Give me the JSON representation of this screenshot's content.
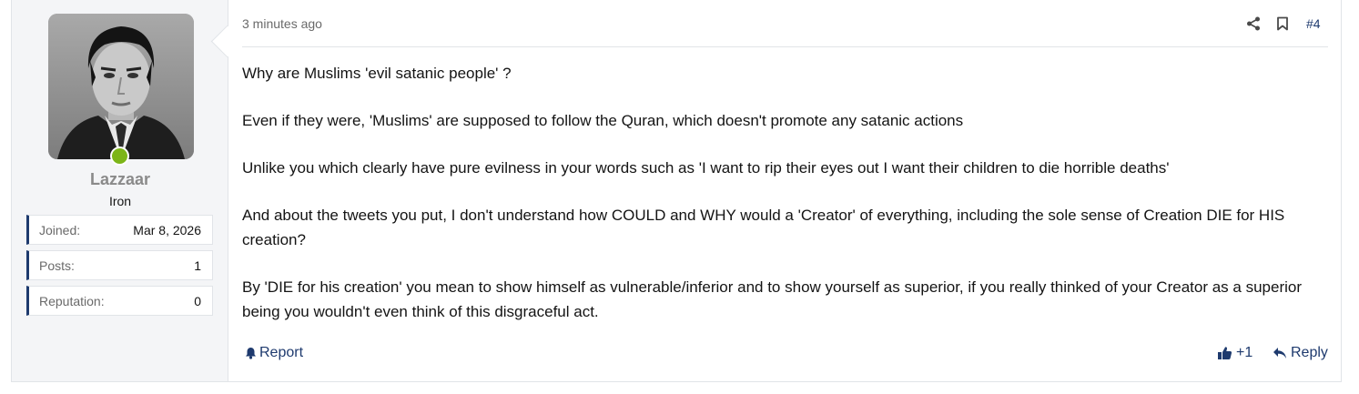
{
  "user": {
    "name": "Lazzaar",
    "title": "Iron",
    "online_color": "#7cb518",
    "stats": [
      {
        "label": "Joined:",
        "value": "Mar 8, 2026"
      },
      {
        "label": "Posts:",
        "value": "1"
      },
      {
        "label": "Reputation:",
        "value": "0"
      }
    ]
  },
  "post": {
    "time": "3 minutes ago",
    "number": "#4",
    "paragraphs": [
      "Why are Muslims 'evil satanic people' ?",
      "Even if they were, 'Muslims' are supposed to follow the Quran, which doesn't promote any satanic actions",
      "Unlike you which clearly have pure evilness in your words such as 'I want to rip their eyes out I want their children to die horrible deaths'",
      "And about the tweets you put, I don't understand how COULD and WHY would a 'Creator' of everything, including the sole sense of Creation DIE for HIS creation?",
      "By 'DIE for his creation' you mean to show himself as vulnerable/inferior and to show yourself as superior, if you really thinked of your Creator as a superior being you wouldn't even think of this disgraceful act."
    ]
  },
  "footer": {
    "report_label": "Report",
    "like_label": "+1",
    "reply_label": "Reply"
  },
  "colors": {
    "accent": "#1e3a6e",
    "muted": "#6a6a6a"
  }
}
